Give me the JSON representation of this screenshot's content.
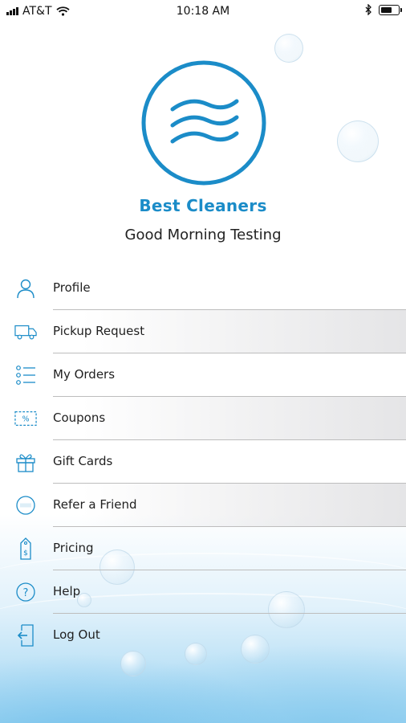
{
  "status_bar": {
    "carrier": "AT&T",
    "time": "10:18 AM"
  },
  "header": {
    "brand": "Best Cleaners",
    "greeting": "Good Morning Testing"
  },
  "colors": {
    "accent": "#1b8cc8"
  },
  "menu": [
    {
      "label": "Profile",
      "icon": "person-icon"
    },
    {
      "label": "Pickup Request",
      "icon": "truck-icon"
    },
    {
      "label": "My Orders",
      "icon": "list-icon"
    },
    {
      "label": "Coupons",
      "icon": "coupon-icon"
    },
    {
      "label": "Gift Cards",
      "icon": "gift-icon"
    },
    {
      "label": "Refer a Friend",
      "icon": "free-badge-icon"
    },
    {
      "label": "Pricing",
      "icon": "price-tag-icon"
    },
    {
      "label": "Help",
      "icon": "help-icon"
    },
    {
      "label": "Log Out",
      "icon": "logout-icon"
    }
  ]
}
